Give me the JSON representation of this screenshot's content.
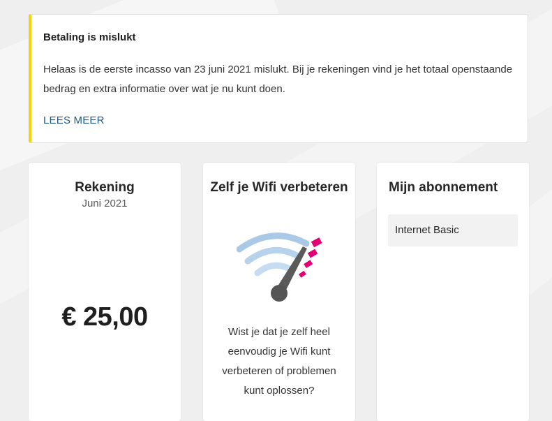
{
  "alert": {
    "title": "Betaling is mislukt",
    "body": "Helaas is de eerste incasso van 23 juni 2021 mislukt. Bij je rekeningen vind je het totaal openstaande bedrag en extra informatie over wat je nu kunt doen.",
    "link_label": "LEES MEER",
    "accent_color": "#f5d30a",
    "link_color": "#1d5b86"
  },
  "invoice_card": {
    "title": "Rekening",
    "period": "Juni 2021",
    "amount": "€ 25,00"
  },
  "wifi_card": {
    "title": "Zelf je Wifi verbeteren",
    "icon": "wifi-speedometer-icon",
    "description": "Wist je dat je zelf heel eenvoudig je Wifi kunt verbeteren of problemen kunt oplossen?",
    "colors": {
      "wave": "#a9c9e6",
      "accent": "#e20074",
      "needle": "#5a5a5a"
    }
  },
  "subscription_card": {
    "title": "Mijn abonnement",
    "plan": "Internet Basic"
  }
}
